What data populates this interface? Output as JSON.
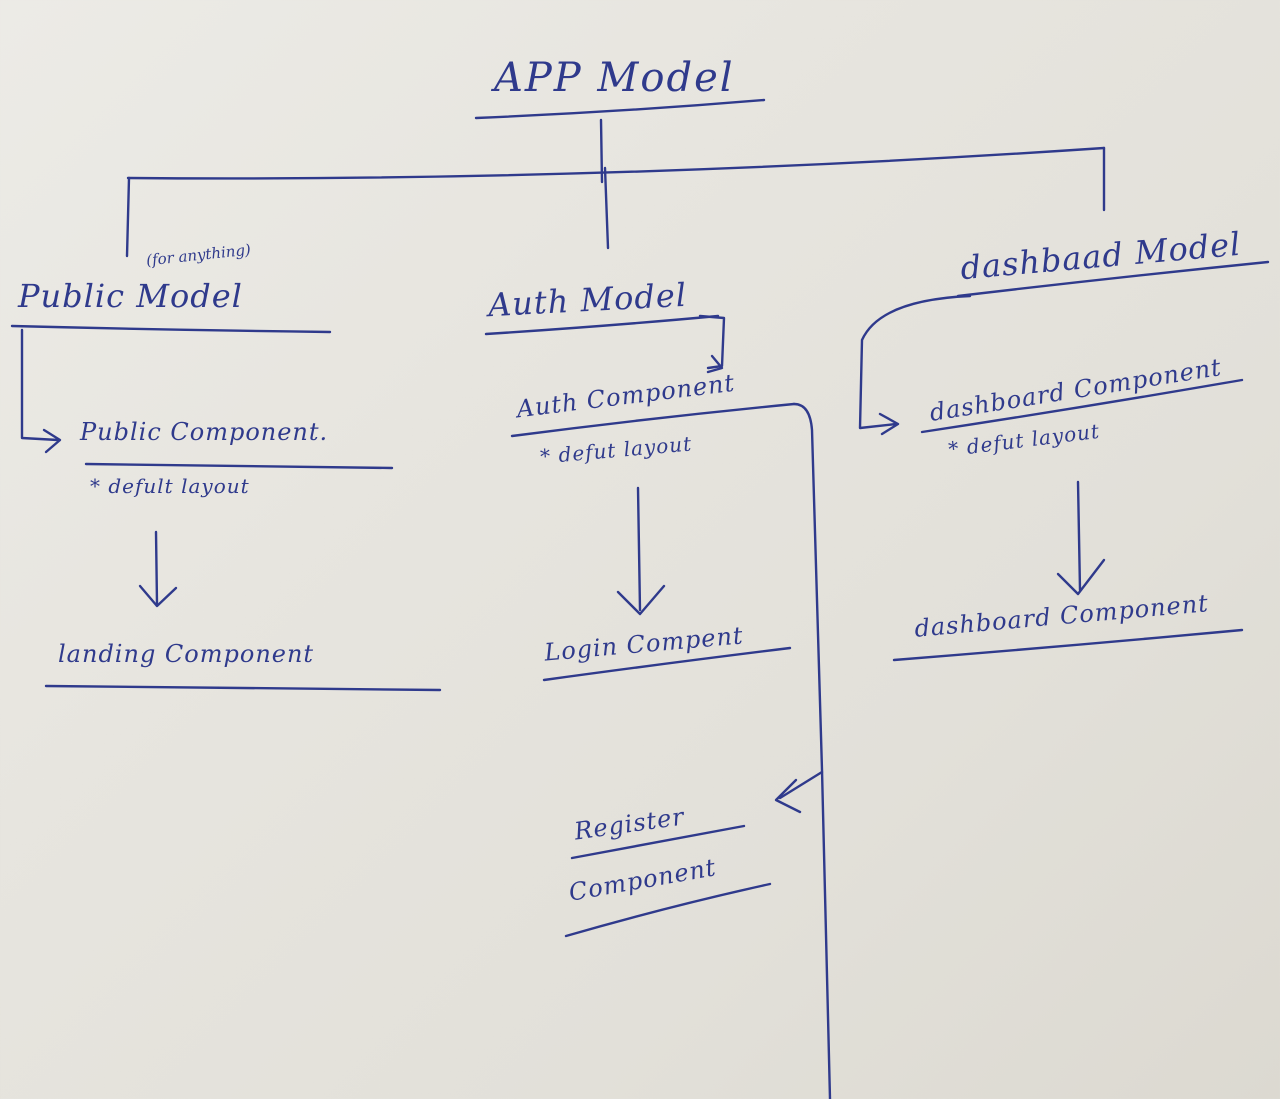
{
  "nodes": {
    "app_model": "APP Model",
    "public_model": "Public Model",
    "public_model_note": "(for anything)",
    "auth_model": "Auth Model",
    "dashboard_model": "dashbaad Model",
    "public_component": "Public Component.",
    "public_layout": "* defult layout",
    "auth_component": "Auth Component",
    "auth_layout": "* defut layout",
    "dashboard_component_layout": "dashboard Component",
    "dashboard_layout": "* defut layout",
    "landing_component": "landing Component",
    "login_component": "Login Compent",
    "dashboard_component": "dashboard Component",
    "register_line1": "Register",
    "register_line2": "Component"
  },
  "colors": {
    "ink": "#2f3a8c",
    "paper": "#e7e5df"
  }
}
